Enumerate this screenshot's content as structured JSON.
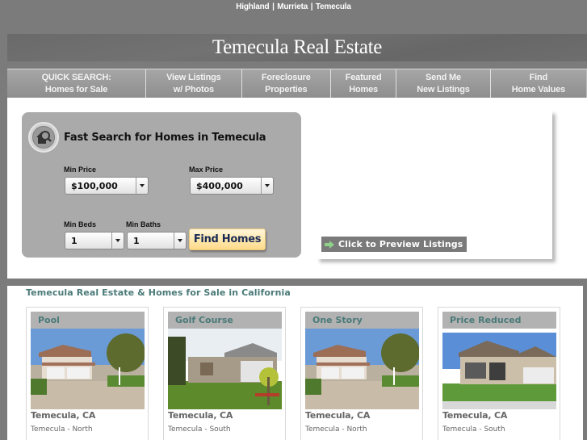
{
  "top_links": [
    "Highland",
    "Murrieta",
    "Temecula"
  ],
  "top_links_separator": "|",
  "banner": {
    "title": "Temecula Real Estate"
  },
  "nav": [
    {
      "line1": "QUICK SEARCH:",
      "line2": "Homes for Sale"
    },
    {
      "line1": "View Listings",
      "line2": "w/ Photos"
    },
    {
      "line1": "Foreclosure",
      "line2": "Properties"
    },
    {
      "line1": "Featured",
      "line2": "Homes"
    },
    {
      "line1": "Send Me",
      "line2": "New Listings"
    },
    {
      "line1": "Find",
      "line2": "Home Values"
    }
  ],
  "search": {
    "icon": "house-magnifier-icon",
    "title": "Fast Search for Homes in Temecula",
    "min_price_label": "Min Price",
    "min_price_value": "$100,000",
    "max_price_label": "Max Price",
    "max_price_value": "$400,000",
    "min_beds_label": "Min Beds",
    "min_beds_value": "1",
    "min_baths_label": "Min Baths",
    "min_baths_value": "1",
    "submit_label": "Find Homes"
  },
  "preview": {
    "button_label": "Click to Preview Listings",
    "icon": "green-arrow-icon"
  },
  "listings": {
    "title": "Temecula Real Estate & Homes for Sale in California",
    "cards": [
      {
        "category": "Pool",
        "city": "Temecula, CA",
        "area": "Temecula - North",
        "photo": "two-story-house"
      },
      {
        "category": "Golf Course",
        "city": "Temecula, CA",
        "area": "Temecula - South",
        "photo": "single-story-house"
      },
      {
        "category": "One Story",
        "city": "Temecula, CA",
        "area": "Temecula - North",
        "photo": "two-story-house"
      },
      {
        "category": "Price Reduced",
        "city": "Temecula, CA",
        "area": "Temecula - South",
        "photo": "two-story-house-b"
      }
    ]
  },
  "colors": {
    "page_bg": "#7b7b7b",
    "accent_teal": "#4a7a78",
    "button_gold": "#ffe7a8",
    "search_panel": "#aaaaaa"
  }
}
